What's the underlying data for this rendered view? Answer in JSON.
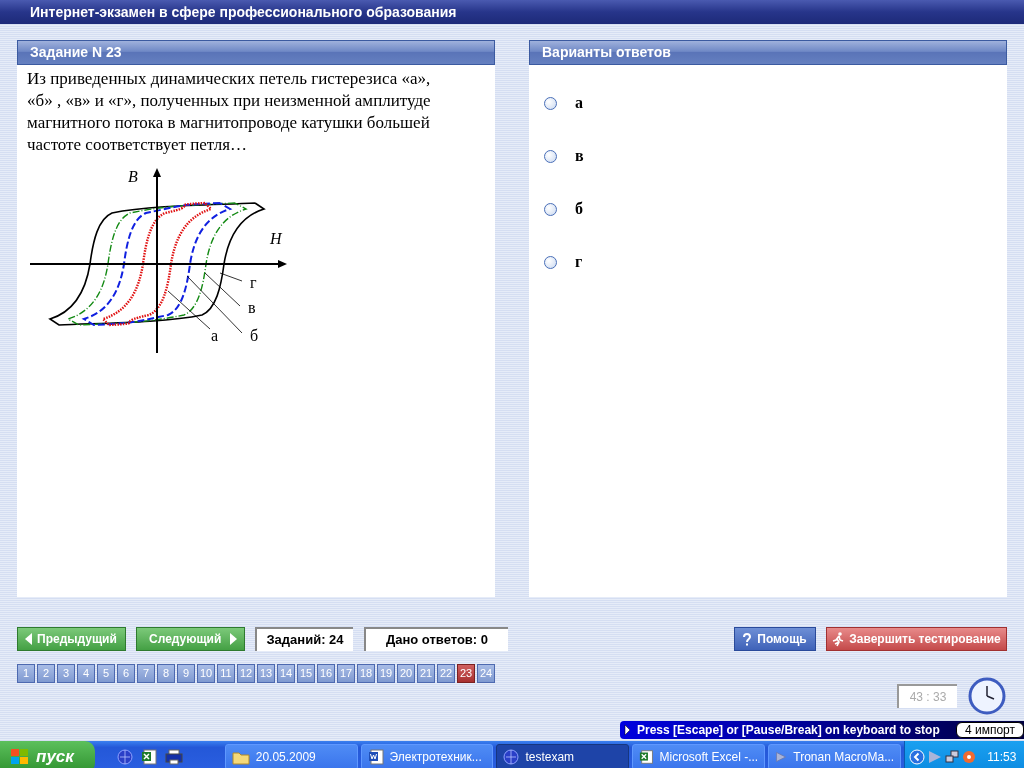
{
  "window": {
    "title": "Интернет-экзамен в сфере профессионального образования"
  },
  "task": {
    "header": "Задание N 23",
    "question": "Из приведенных динамических петель гистерезиса «а», «б» , «в» и «г», полученных при неизменной амплитуде магнитного потока в магнитопроводе катушки большей частоте соответствует петля…",
    "figure": {
      "y_axis": "B",
      "x_axis": "H",
      "loop_labels": [
        "г",
        "в",
        "а",
        "б"
      ]
    }
  },
  "answers": {
    "header": "Варианты ответов",
    "options": [
      {
        "label": "а",
        "selected": false
      },
      {
        "label": "в",
        "selected": false
      },
      {
        "label": "б",
        "selected": false
      },
      {
        "label": "г",
        "selected": false
      }
    ]
  },
  "nav": {
    "prev": "Предыдущий",
    "next": "Следующий",
    "total": "Заданий: 24",
    "answered": "Дано ответов: 0",
    "help": "Помощь",
    "finish": "Завершить тестирование"
  },
  "pages": [
    {
      "label": "1",
      "selected": false
    },
    {
      "label": "2",
      "selected": false
    },
    {
      "label": "3",
      "selected": false
    },
    {
      "label": "4",
      "selected": false
    },
    {
      "label": "5",
      "selected": false
    },
    {
      "label": "6",
      "selected": false
    },
    {
      "label": "7",
      "selected": false
    },
    {
      "label": "8",
      "selected": false
    },
    {
      "label": "9",
      "selected": false
    },
    {
      "label": "10",
      "selected": false
    },
    {
      "label": "11",
      "selected": false
    },
    {
      "label": "12",
      "selected": false
    },
    {
      "label": "13",
      "selected": false
    },
    {
      "label": "14",
      "selected": false
    },
    {
      "label": "15",
      "selected": false
    },
    {
      "label": "16",
      "selected": false
    },
    {
      "label": "17",
      "selected": false
    },
    {
      "label": "18",
      "selected": false
    },
    {
      "label": "19",
      "selected": false
    },
    {
      "label": "20",
      "selected": false
    },
    {
      "label": "21",
      "selected": false
    },
    {
      "label": "22",
      "selected": false
    },
    {
      "label": "23",
      "selected": true
    },
    {
      "label": "24",
      "selected": false
    }
  ],
  "timer": "43 : 33",
  "macro_bar": {
    "message": "Press [Escape] or [Pause/Break] on keyboard to stop",
    "status": "4 импорт"
  },
  "taskbar": {
    "start": "пуск",
    "quick_launch": [
      {
        "kind": "globe"
      },
      {
        "kind": "excel"
      },
      {
        "kind": "bmp"
      }
    ],
    "tasks": [
      {
        "kind": "folder",
        "label": "20.05.2009",
        "selected": false
      },
      {
        "kind": "word",
        "label": "Электротехник...",
        "selected": false
      },
      {
        "kind": "globe",
        "label": "testexam",
        "selected": true
      },
      {
        "kind": "excel",
        "label": "Microsoft Excel -...",
        "selected": false
      },
      {
        "kind": "play",
        "label": "Tronan MacroMa...",
        "selected": false
      }
    ],
    "clock": "11:53"
  }
}
